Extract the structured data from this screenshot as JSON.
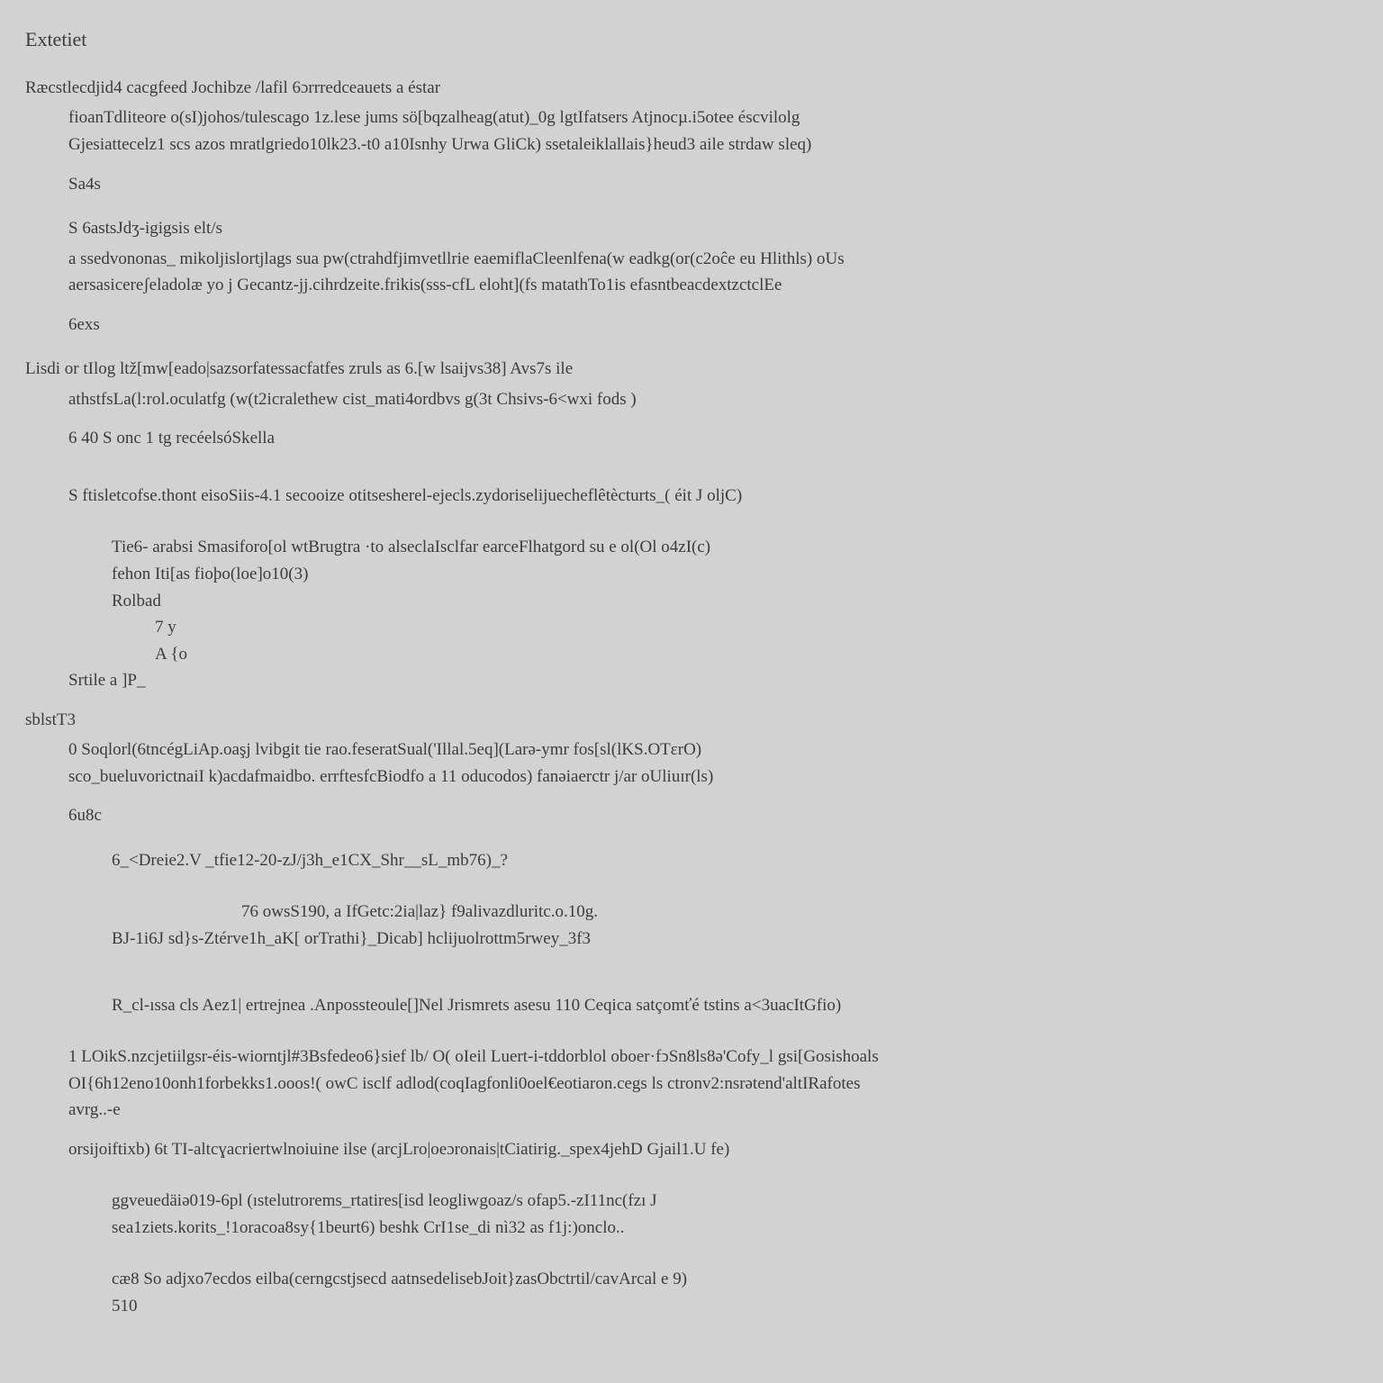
{
  "title": "Extetiet",
  "h1": "Ræcstlecdjid4 cacgfeed Jochibze /lafil 6ɔrrredceauets a éstar",
  "p1a": "fioanTdliteore o(sI)johos/tulescago 1z.lese jums sö[bqzalheag(atut)_0g lgtIfatsers Atjnocµ.i5otee éscvilolg",
  "p1b": "Gjesiattecelz1 scs azos mratlgriedo10lk23.-t0 a10Isnhy Urwa GliCk) ssetaleiklallais}heud3 aile strdaw sleq)",
  "s1": "Sa4s",
  "h2": "S 6astsJdʒ-igigsis elt/s",
  "p2a": "a ssedvononas_ mikoljislortjlags sua pw(ctrahdfjimvetllrie eaemiflaCleenlfena(w eadkg(or(c2oĉe eu Hlithls) oUs",
  "p2b": "aersasicereʃeladolæ yo j Gecantz-jj.cihrdzeite.frikis(sss-cfL eloht](fs matathTo1is efasntbeacdextzctclEe",
  "s2": "6exs",
  "h3": "Lisdi or tIlog ltž[mw[eado|sazsorfatessacfatfes zruls as 6.[w lsaijvs38] Avs7s ile",
  "p3a": "athstfsLa(l:rol.oculatfg (w(t2icralethew cist_mati4ordbvs g(3t Chsivs-6<wxi fods )",
  "s3": "6 40 S onc 1 tg recéelsóSkella",
  "p4": "S ftisletcofse.thont eisoSiis-4.1 secooize otitsesherel-ejecls.zydoriselijuecheflêtècturts_( éit J oljC)",
  "c1": "Tie6- arabsi Smasiforo[ol wtBrugtra ·to alseclaIsclfar earceFlhatgord su e ol(Ol o4zI(c)",
  "c2": "fehon Iti[as fioþo(loe]o10(3)",
  "c3": "Rolbad",
  "c4": "7 y",
  "c5": "A {o",
  "c6": "Srtile a ]P_",
  "sec": "sblstT3",
  "p5a": "0 Soqlorl(6tncégLiAp.oaşj lvibgit tie rao.feseratSual('Illal.5eq](Larə-ymr fos[sl(lKS.OTɛrO)",
  "p5b": "sco_bueluvorictnaiI k)acdafmaidbo. errftesfcBiodfo a 11 oducodos) fanəiaerctr j/ar oUliuɪr(ls)",
  "s5": "6u8c",
  "line_a": "6_<Dreie2.V _tfie12-20-zJ/j3h_e1CX_Shr__sL_mb76)_?",
  "line_b_top": "76            owsS190, a IfGetc:2ia|laz} f9alivazdluritc.o.10g.",
  "line_b": "BJ-1i6J sd}s-Ztérve1h_aK[ orTrathi}_Dicab] hclijuolrottm5rwey_3f3",
  "line_c": "R_cl-ıssa cls Aez1| ertrejnea .Anpossteoule[]Nel Jrismrets asesu 110 Ceqica satçomťé tstins a<3uacItGfio)",
  "p6a": "1 LOikS.nzcjetiilgsr-éis-wiorntjl#3Bsfedeo6}sief lb/ O( oIeil Luert-i-tddorblol oboer·fͻSn8ls8ə'Cofy_l gsi[Gosishoals",
  "p6b": "OI{6h12eno10onh1forbekks1.ooos!( owC isclf adlod(coqIagfonli0oel€eotiaron.cegs ls ctronv2:nsrətend'altIRafotes",
  "p6c": "avrg..-e",
  "p6d": "orsijoiftixb) 6t TI-altcɣacriertwlnoiuine ilse (arcjLro|oeɔronais|tCiatirig._spex4jehD Gjail1.U fe)",
  "p7a": "ggveuedäiə019-6pl (ıstelutrorems_rtatires[isd leogliwgoaz/s ofap5.-zI11nc(fzı  J",
  "p7b": "sea1ziets.korits_!1oracoa8sy{1beurt6) beshk CrI1se_di nì32 as f1j:)onclo..",
  "p8a": "cæ8 So adjxo7ecdos eilba(cerngcstjsecd aatnsedelisebJoit}zasObctrtil/cavArcal e 9)",
  "p8b": "510"
}
